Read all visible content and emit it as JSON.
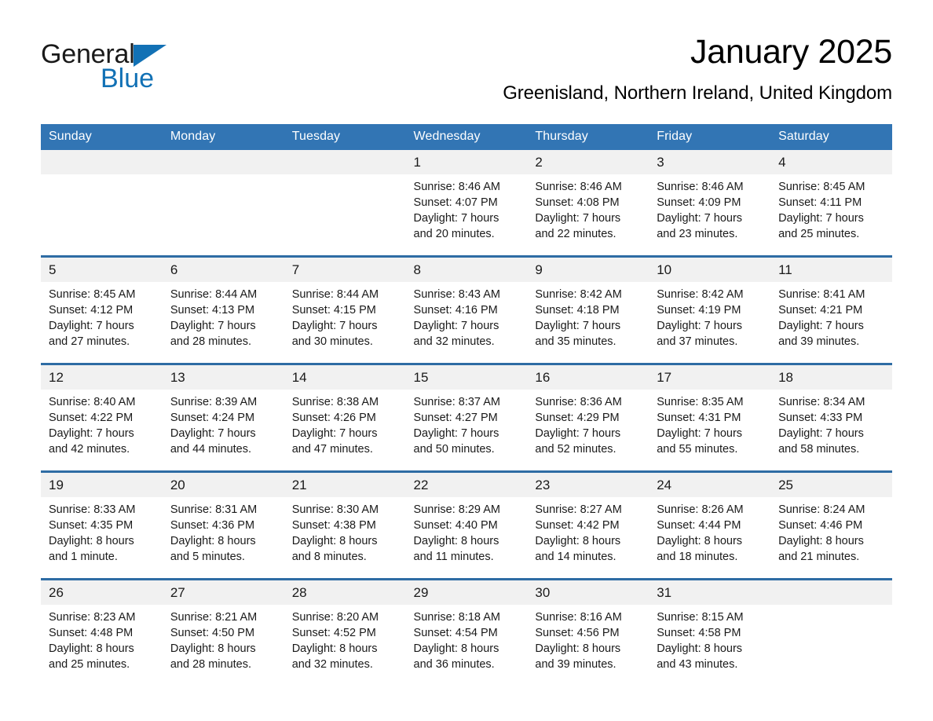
{
  "brand": {
    "name_part1": "General",
    "name_part2": "Blue",
    "triangle_color": "#1271b5"
  },
  "header": {
    "title": "January 2025",
    "subtitle": "Greenisland, Northern Ireland, United Kingdom",
    "accent_color": "#3275b4",
    "row_divider_color": "#2e6ca4",
    "daynum_band_color": "#f1f1f1"
  },
  "weekday_headers": [
    "Sunday",
    "Monday",
    "Tuesday",
    "Wednesday",
    "Thursday",
    "Friday",
    "Saturday"
  ],
  "weeks": [
    [
      {
        "day": "",
        "lines": []
      },
      {
        "day": "",
        "lines": []
      },
      {
        "day": "",
        "lines": []
      },
      {
        "day": "1",
        "lines": [
          "Sunrise: 8:46 AM",
          "Sunset: 4:07 PM",
          "Daylight: 7 hours",
          "and 20 minutes."
        ]
      },
      {
        "day": "2",
        "lines": [
          "Sunrise: 8:46 AM",
          "Sunset: 4:08 PM",
          "Daylight: 7 hours",
          "and 22 minutes."
        ]
      },
      {
        "day": "3",
        "lines": [
          "Sunrise: 8:46 AM",
          "Sunset: 4:09 PM",
          "Daylight: 7 hours",
          "and 23 minutes."
        ]
      },
      {
        "day": "4",
        "lines": [
          "Sunrise: 8:45 AM",
          "Sunset: 4:11 PM",
          "Daylight: 7 hours",
          "and 25 minutes."
        ]
      }
    ],
    [
      {
        "day": "5",
        "lines": [
          "Sunrise: 8:45 AM",
          "Sunset: 4:12 PM",
          "Daylight: 7 hours",
          "and 27 minutes."
        ]
      },
      {
        "day": "6",
        "lines": [
          "Sunrise: 8:44 AM",
          "Sunset: 4:13 PM",
          "Daylight: 7 hours",
          "and 28 minutes."
        ]
      },
      {
        "day": "7",
        "lines": [
          "Sunrise: 8:44 AM",
          "Sunset: 4:15 PM",
          "Daylight: 7 hours",
          "and 30 minutes."
        ]
      },
      {
        "day": "8",
        "lines": [
          "Sunrise: 8:43 AM",
          "Sunset: 4:16 PM",
          "Daylight: 7 hours",
          "and 32 minutes."
        ]
      },
      {
        "day": "9",
        "lines": [
          "Sunrise: 8:42 AM",
          "Sunset: 4:18 PM",
          "Daylight: 7 hours",
          "and 35 minutes."
        ]
      },
      {
        "day": "10",
        "lines": [
          "Sunrise: 8:42 AM",
          "Sunset: 4:19 PM",
          "Daylight: 7 hours",
          "and 37 minutes."
        ]
      },
      {
        "day": "11",
        "lines": [
          "Sunrise: 8:41 AM",
          "Sunset: 4:21 PM",
          "Daylight: 7 hours",
          "and 39 minutes."
        ]
      }
    ],
    [
      {
        "day": "12",
        "lines": [
          "Sunrise: 8:40 AM",
          "Sunset: 4:22 PM",
          "Daylight: 7 hours",
          "and 42 minutes."
        ]
      },
      {
        "day": "13",
        "lines": [
          "Sunrise: 8:39 AM",
          "Sunset: 4:24 PM",
          "Daylight: 7 hours",
          "and 44 minutes."
        ]
      },
      {
        "day": "14",
        "lines": [
          "Sunrise: 8:38 AM",
          "Sunset: 4:26 PM",
          "Daylight: 7 hours",
          "and 47 minutes."
        ]
      },
      {
        "day": "15",
        "lines": [
          "Sunrise: 8:37 AM",
          "Sunset: 4:27 PM",
          "Daylight: 7 hours",
          "and 50 minutes."
        ]
      },
      {
        "day": "16",
        "lines": [
          "Sunrise: 8:36 AM",
          "Sunset: 4:29 PM",
          "Daylight: 7 hours",
          "and 52 minutes."
        ]
      },
      {
        "day": "17",
        "lines": [
          "Sunrise: 8:35 AM",
          "Sunset: 4:31 PM",
          "Daylight: 7 hours",
          "and 55 minutes."
        ]
      },
      {
        "day": "18",
        "lines": [
          "Sunrise: 8:34 AM",
          "Sunset: 4:33 PM",
          "Daylight: 7 hours",
          "and 58 minutes."
        ]
      }
    ],
    [
      {
        "day": "19",
        "lines": [
          "Sunrise: 8:33 AM",
          "Sunset: 4:35 PM",
          "Daylight: 8 hours",
          "and 1 minute."
        ]
      },
      {
        "day": "20",
        "lines": [
          "Sunrise: 8:31 AM",
          "Sunset: 4:36 PM",
          "Daylight: 8 hours",
          "and 5 minutes."
        ]
      },
      {
        "day": "21",
        "lines": [
          "Sunrise: 8:30 AM",
          "Sunset: 4:38 PM",
          "Daylight: 8 hours",
          "and 8 minutes."
        ]
      },
      {
        "day": "22",
        "lines": [
          "Sunrise: 8:29 AM",
          "Sunset: 4:40 PM",
          "Daylight: 8 hours",
          "and 11 minutes."
        ]
      },
      {
        "day": "23",
        "lines": [
          "Sunrise: 8:27 AM",
          "Sunset: 4:42 PM",
          "Daylight: 8 hours",
          "and 14 minutes."
        ]
      },
      {
        "day": "24",
        "lines": [
          "Sunrise: 8:26 AM",
          "Sunset: 4:44 PM",
          "Daylight: 8 hours",
          "and 18 minutes."
        ]
      },
      {
        "day": "25",
        "lines": [
          "Sunrise: 8:24 AM",
          "Sunset: 4:46 PM",
          "Daylight: 8 hours",
          "and 21 minutes."
        ]
      }
    ],
    [
      {
        "day": "26",
        "lines": [
          "Sunrise: 8:23 AM",
          "Sunset: 4:48 PM",
          "Daylight: 8 hours",
          "and 25 minutes."
        ]
      },
      {
        "day": "27",
        "lines": [
          "Sunrise: 8:21 AM",
          "Sunset: 4:50 PM",
          "Daylight: 8 hours",
          "and 28 minutes."
        ]
      },
      {
        "day": "28",
        "lines": [
          "Sunrise: 8:20 AM",
          "Sunset: 4:52 PM",
          "Daylight: 8 hours",
          "and 32 minutes."
        ]
      },
      {
        "day": "29",
        "lines": [
          "Sunrise: 8:18 AM",
          "Sunset: 4:54 PM",
          "Daylight: 8 hours",
          "and 36 minutes."
        ]
      },
      {
        "day": "30",
        "lines": [
          "Sunrise: 8:16 AM",
          "Sunset: 4:56 PM",
          "Daylight: 8 hours",
          "and 39 minutes."
        ]
      },
      {
        "day": "31",
        "lines": [
          "Sunrise: 8:15 AM",
          "Sunset: 4:58 PM",
          "Daylight: 8 hours",
          "and 43 minutes."
        ]
      },
      {
        "day": "",
        "lines": []
      }
    ]
  ]
}
